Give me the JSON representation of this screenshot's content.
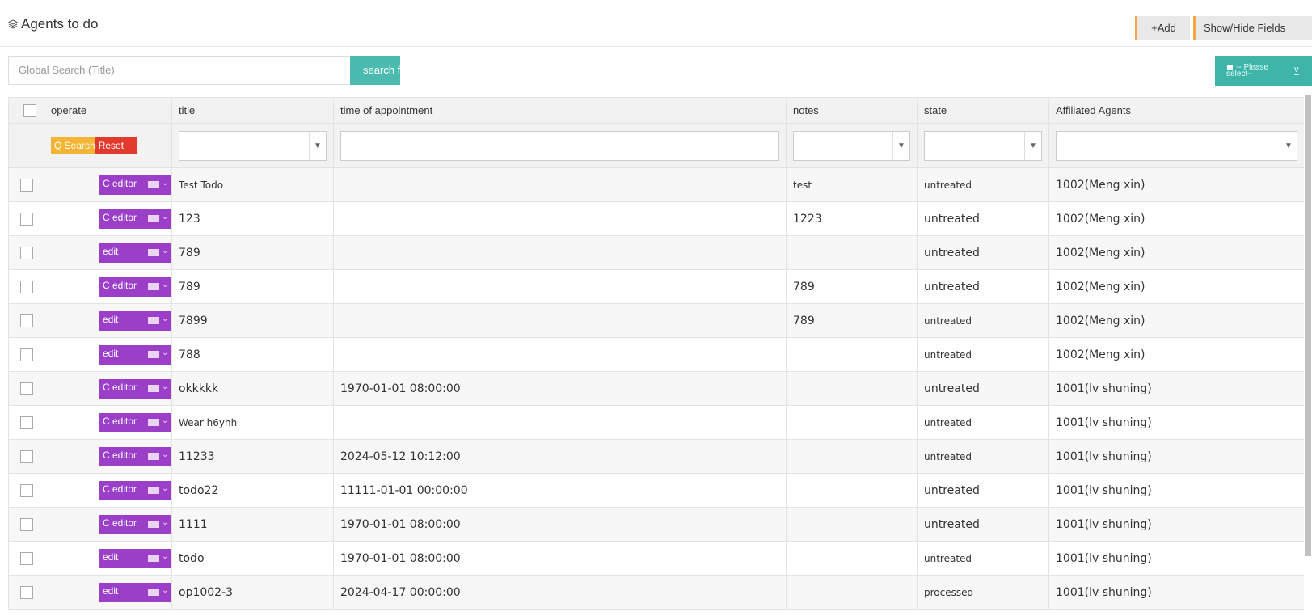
{
  "header": {
    "title": "Agents to do",
    "add_label": "+Add",
    "fields_label": "Show/Hide Fields"
  },
  "search": {
    "placeholder": "Global Search (Title)",
    "button_label": "search f",
    "select_line1": "-- Please",
    "select_line2": "select--"
  },
  "table": {
    "columns": [
      "operate",
      "title",
      "time of appointment",
      "notes",
      "state",
      "Affiliated Agents"
    ],
    "quick_search_label": "Q Search",
    "reset_label": "Reset",
    "rows": [
      {
        "action": "C editor",
        "title": "Test Todo",
        "time": "",
        "notes": "test",
        "state": "untreated",
        "agent": "1002(Meng xin)"
      },
      {
        "action": "C editor",
        "title": "123",
        "time": "",
        "notes": "1223",
        "state": "untreated",
        "agent": "1002(Meng xin)"
      },
      {
        "action": "edit",
        "title": "789",
        "time": "",
        "notes": "",
        "state": "untreated",
        "agent": "1002(Meng xin)"
      },
      {
        "action": "C editor",
        "title": "789",
        "time": "",
        "notes": "789",
        "state": "untreated",
        "agent": "1002(Meng xin)"
      },
      {
        "action": "edit",
        "title": "7899",
        "time": "",
        "notes": "789",
        "state": "untreated",
        "agent": "1002(Meng xin)"
      },
      {
        "action": "edit",
        "title": "788",
        "time": "",
        "notes": "",
        "state": "untreated",
        "agent": "1002(Meng xin)"
      },
      {
        "action": "C editor",
        "title": "okkkkk",
        "time": "1970-01-01 08:00:00",
        "notes": "",
        "state": "untreated",
        "agent": "1001(lv shuning)"
      },
      {
        "action": "C editor",
        "title": "Wear h6yhh",
        "time": "",
        "notes": "",
        "state": "untreated",
        "agent": "1001(lv shuning)"
      },
      {
        "action": "C editor",
        "title": "11233",
        "time": "2024-05-12 10:12:00",
        "notes": "",
        "state": "untreated",
        "agent": "1001(lv shuning)"
      },
      {
        "action": "C editor",
        "title": "todo22",
        "time": "11111-01-01 00:00:00",
        "notes": "",
        "state": "untreated",
        "agent": "1001(lv shuning)"
      },
      {
        "action": "C editor",
        "title": "1111",
        "time": "1970-01-01 08:00:00",
        "notes": "",
        "state": "untreated",
        "agent": "1001(lv shuning)"
      },
      {
        "action": "edit",
        "title": "todo",
        "time": "1970-01-01 08:00:00",
        "notes": "",
        "state": "untreated",
        "agent": "1001(lv shuning)"
      },
      {
        "action": "edit",
        "title": "op1002-3",
        "time": "2024-04-17 00:00:00",
        "notes": "",
        "state": "processed",
        "agent": "1001(lv shuning)"
      }
    ]
  },
  "colors": {
    "accent_orange": "#f3a540",
    "teal": "#4bbbaf",
    "purple": "#9b3fc8",
    "search_yellow": "#f5b433",
    "reset_red": "#e23b2e"
  }
}
